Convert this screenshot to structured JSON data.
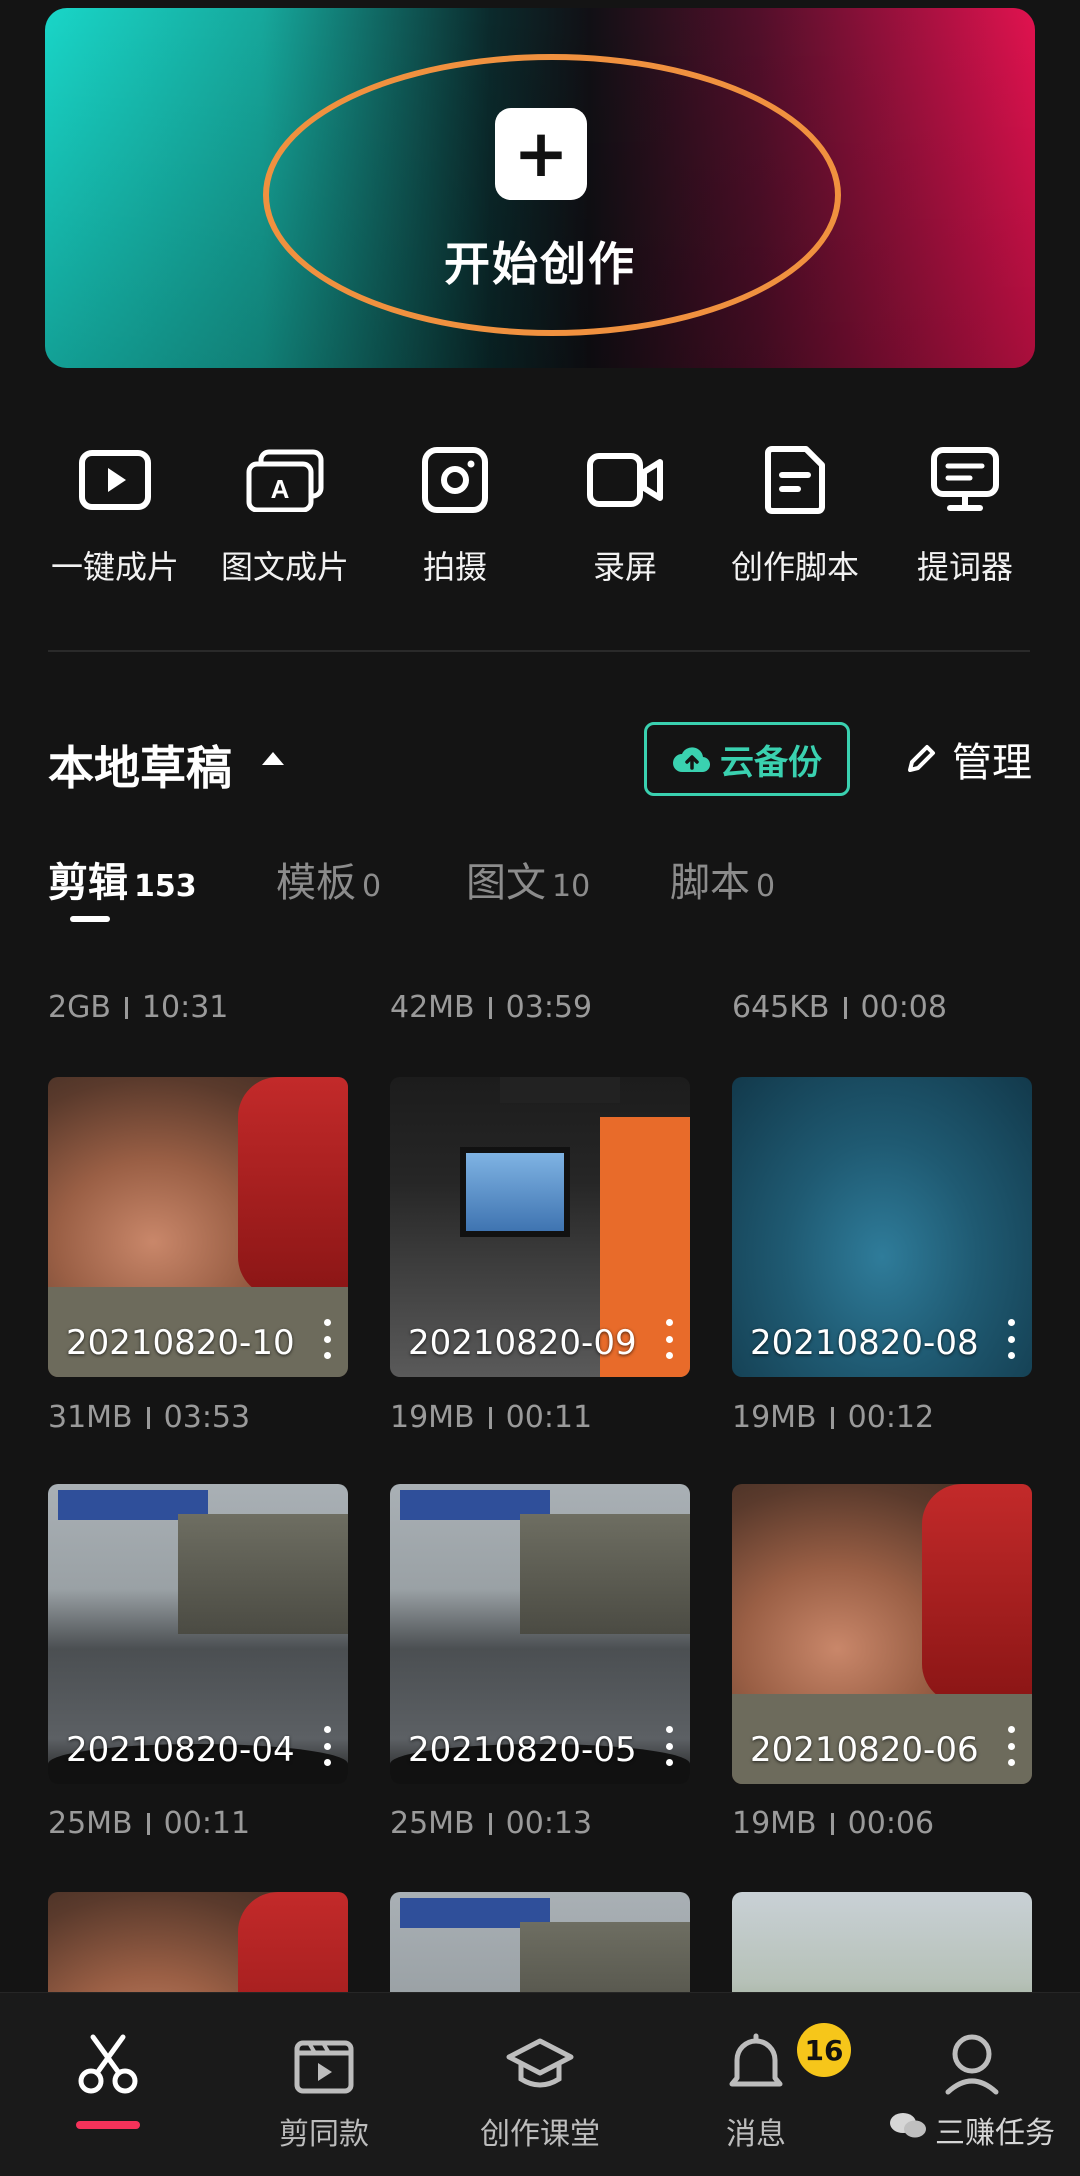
{
  "hero": {
    "title": "开始创作",
    "plus": "+"
  },
  "tools": [
    {
      "label": "一键成片",
      "icon": "play-icon"
    },
    {
      "label": "图文成片",
      "icon": "text-to-video-icon"
    },
    {
      "label": "拍摄",
      "icon": "camera-icon"
    },
    {
      "label": "录屏",
      "icon": "screen-record-icon"
    },
    {
      "label": "创作脚本",
      "icon": "script-icon"
    },
    {
      "label": "提词器",
      "icon": "teleprompter-icon"
    }
  ],
  "drafts": {
    "title": "本地草稿",
    "cloud_backup": "云备份",
    "manage": "管理"
  },
  "tabs": [
    {
      "name": "剪辑",
      "count": "153",
      "active": true
    },
    {
      "name": "模板",
      "count": "0"
    },
    {
      "name": "图文",
      "count": "10"
    },
    {
      "name": "脚本",
      "count": "0"
    }
  ],
  "top_meta": [
    {
      "size": "2GB",
      "duration": "10:31"
    },
    {
      "size": "42MB",
      "duration": "03:59"
    },
    {
      "size": "645KB",
      "duration": "00:08"
    }
  ],
  "projects": [
    {
      "title": "20210820-10",
      "size": "31MB",
      "duration": "03:53"
    },
    {
      "title": "20210820-09",
      "size": "19MB",
      "duration": "00:11"
    },
    {
      "title": "20210820-08",
      "size": "19MB",
      "duration": "00:12"
    },
    {
      "title": "20210820-04",
      "size": "25MB",
      "duration": "00:11"
    },
    {
      "title": "20210820-05",
      "size": "25MB",
      "duration": "00:13"
    },
    {
      "title": "20210820-06",
      "size": "19MB",
      "duration": "00:06"
    }
  ],
  "nav": [
    {
      "label": "",
      "icon": "scissors-icon",
      "active": true
    },
    {
      "label": "剪同款",
      "icon": "template-icon"
    },
    {
      "label": "创作课堂",
      "icon": "graduation-cap-icon"
    },
    {
      "label": "消息",
      "icon": "bell-icon"
    },
    {
      "label": "",
      "icon": "profile-icon"
    }
  ],
  "badge": "16",
  "watermark": "三赚任务",
  "colors": {
    "accent": "#3ad1b0",
    "highlight_ring": "#f0913f",
    "nav_active": "#f5325a",
    "badge": "#f6c61a"
  }
}
